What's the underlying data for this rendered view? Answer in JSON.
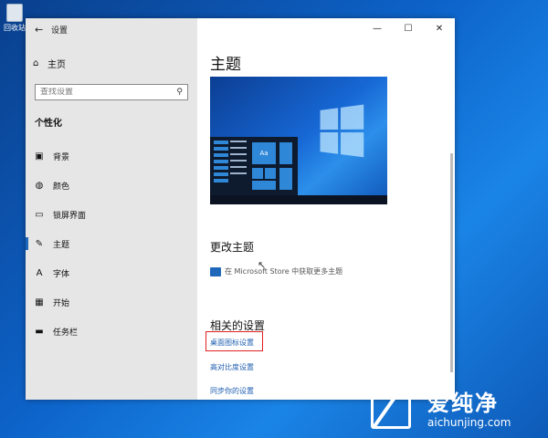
{
  "desktop": {
    "recycle_bin_label": "回收站"
  },
  "window": {
    "title": "设置",
    "controls": {
      "minimize": "—",
      "maximize": "☐",
      "close": "✕"
    }
  },
  "sidebar": {
    "home_label": "主页",
    "search_placeholder": "查找设置",
    "section_heading": "个性化",
    "items": [
      {
        "label": "背景",
        "icon": "picture-icon",
        "glyph": "▣",
        "active": false
      },
      {
        "label": "颜色",
        "icon": "palette-icon",
        "glyph": "◍",
        "active": false
      },
      {
        "label": "锁屏界面",
        "icon": "lockscreen-icon",
        "glyph": "▭",
        "active": false
      },
      {
        "label": "主题",
        "icon": "theme-icon",
        "glyph": "✎",
        "active": true
      },
      {
        "label": "字体",
        "icon": "font-icon",
        "glyph": "A",
        "active": false
      },
      {
        "label": "开始",
        "icon": "start-icon",
        "glyph": "▦",
        "active": false
      },
      {
        "label": "任务栏",
        "icon": "taskbar-icon",
        "glyph": "▬",
        "active": false
      }
    ]
  },
  "main": {
    "title": "主题",
    "preview_tile_text": "Aa",
    "change_theme_heading": "更改主题",
    "store_link": "在 Microsoft Store 中获取更多主题",
    "related_heading": "相关的设置",
    "related_links": [
      "桌面图标设置",
      "高对比度设置",
      "同步你的设置"
    ]
  },
  "watermark": {
    "name": "爱纯净",
    "url": "aichunjing.com"
  },
  "colors": {
    "accent": "#1f67b8",
    "link": "#1f5fb0",
    "highlight": "#e02020",
    "sidebar_bg": "#e6e6e6"
  }
}
